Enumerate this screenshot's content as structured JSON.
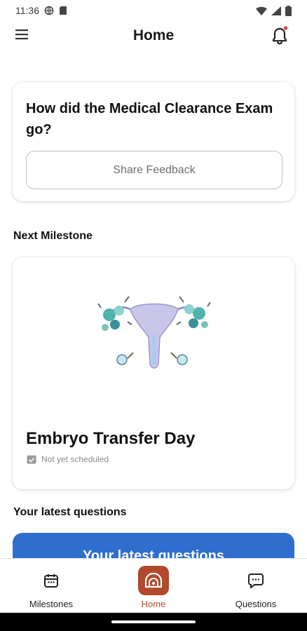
{
  "status_bar": {
    "time": "11:36"
  },
  "app_bar": {
    "title": "Home"
  },
  "feedback_card": {
    "question": "How did the Medical Clearance Exam go?",
    "button_label": "Share Feedback"
  },
  "next_milestone": {
    "section_label": "Next Milestone",
    "title": "Embryo Transfer Day",
    "status": "Not yet scheduled"
  },
  "latest_questions": {
    "section_label": "Your latest questions",
    "card_title": "Your latest questions"
  },
  "bottom_nav": {
    "items": [
      {
        "label": "Milestones",
        "icon": "calendar-icon"
      },
      {
        "label": "Home",
        "icon": "home-icon",
        "active": true
      },
      {
        "label": "Questions",
        "icon": "chat-bubble-icon"
      }
    ]
  },
  "colors": {
    "accent": "#b14a2c",
    "questions_card": "#2f6ecf",
    "notification_dot": "#e53935"
  }
}
